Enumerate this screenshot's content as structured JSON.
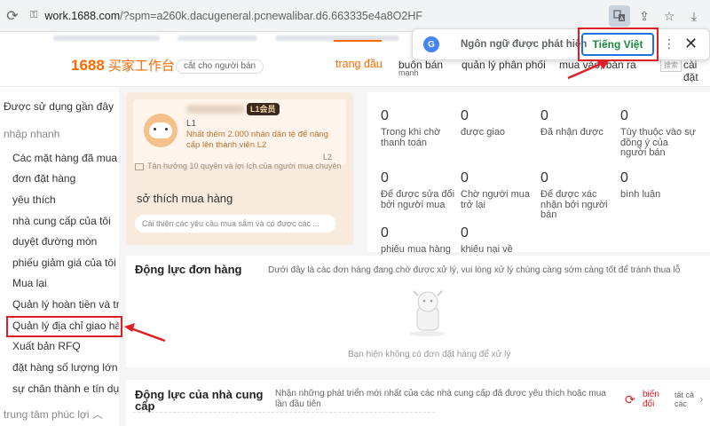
{
  "browser": {
    "url_host": "work.1688.com",
    "url_path": "/?spm=a260k.dacugeneral.pcnewalibar.d6.663335e4a8O2HF"
  },
  "translate_popup": {
    "label": "Ngôn ngữ được phát hiện",
    "target_language": "Tiếng Việt"
  },
  "header": {
    "logo_text": "1688",
    "logo_cn": "买家工作台",
    "chip": "cắt cho người bán",
    "nav_home": "trang đầu",
    "nav_items": [
      "buôn bán",
      "quản lý phân phối",
      "mua vào, bán ra",
      "cài đặt"
    ],
    "nav_sub": "mạnh",
    "search_placeholder": "搜索"
  },
  "sidebar": {
    "recent": "Được sử dụng gần đây",
    "quick_section": "nhập nhanh",
    "items": [
      "Các mặt hàng đã mua",
      "đơn đặt hàng",
      "yêu thích",
      "nhà cung cấp của tôi",
      "duyệt đường mòn",
      "phiếu giảm giá của tôi",
      "Mua lại",
      "Quản lý hoàn tiền và tra",
      "Quản lý địa chỉ giao hàng",
      "Xuất bản RFQ",
      "đặt hàng số lượng lớn",
      "sự chân thành e tín dụng"
    ],
    "welfare_section": "trung tâm phúc lợi"
  },
  "profile": {
    "level_badge": "L1会员",
    "level": "L1",
    "level_desc": "Nhất thêm 2.000 nhân dân tệ để nâng cấp lên thành viên L2",
    "next_level": "L2",
    "benefit": "Tận hưởng 10 quyền và lợi ích của người mua chuyên",
    "pref_title": "sở thích mua hàng",
    "pref_input": "Cải thiện các yêu cầu mua sắm và có được các ..."
  },
  "orders": [
    {
      "value": "0",
      "label": "Trong khi chờ thanh toán"
    },
    {
      "value": "0",
      "label": "được giao"
    },
    {
      "value": "0",
      "label": "Đã nhận được"
    },
    {
      "value": "0",
      "label": "Tùy thuộc vào sự đồng ý của người bán"
    },
    {
      "value": "0",
      "label": "Để được sửa đổi bởi người mua"
    },
    {
      "value": "0",
      "label": "Chờ người mua trở lại"
    },
    {
      "value": "0",
      "label": "Để được xác nhận bởi người bán"
    },
    {
      "value": "0",
      "label": "bình luận"
    },
    {
      "value": "0",
      "label": "phiếu mua hàng"
    },
    {
      "value": "0",
      "label": "khiếu nại về quyền"
    }
  ],
  "dynamics": {
    "title": "Động lực đơn hàng",
    "subtitle": "Dưới đây là các đơn hàng đang chờ được xử lý, vui lòng xử lý chúng càng sớm càng tốt để tránh thua lỗ",
    "empty": "Bạn hiện không có đơn đặt hàng để xử lý"
  },
  "supplier": {
    "title": "Động lực của nhà cung cấp",
    "subtitle": "Nhận những phát triển mới nhất của các nhà cung cấp đã được yêu thích hoặc mua lần đầu tiên",
    "change": "biến đổi",
    "all": "tất cả các"
  }
}
